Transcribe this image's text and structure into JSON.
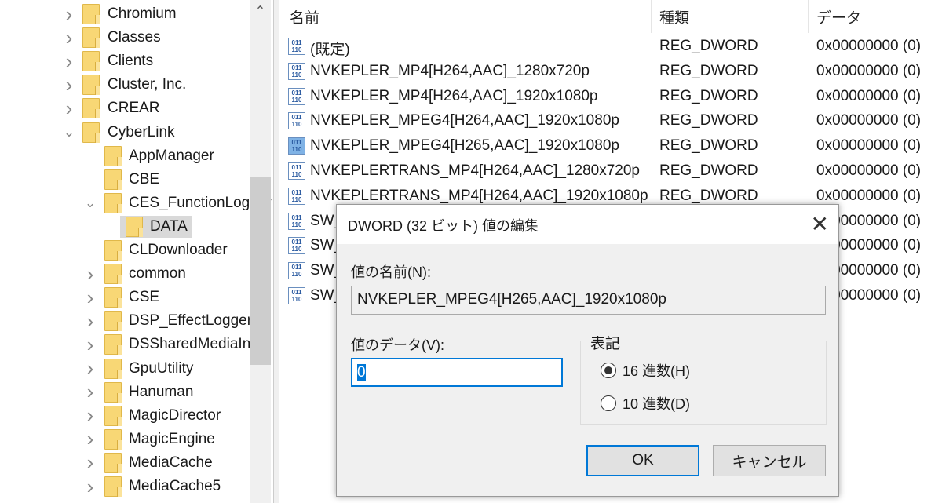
{
  "tree": {
    "items": [
      {
        "label": "Chromium",
        "level": 1,
        "state": "collapsed"
      },
      {
        "label": "Classes",
        "level": 1,
        "state": "collapsed"
      },
      {
        "label": "Clients",
        "level": 1,
        "state": "collapsed"
      },
      {
        "label": "Cluster, Inc.",
        "level": 1,
        "state": "collapsed"
      },
      {
        "label": "CREAR",
        "level": 1,
        "state": "collapsed"
      },
      {
        "label": "CyberLink",
        "level": 1,
        "state": "expanded"
      },
      {
        "label": "AppManager",
        "level": 2,
        "state": "leaf"
      },
      {
        "label": "CBE",
        "level": 2,
        "state": "leaf"
      },
      {
        "label": "CES_FunctionLogger",
        "level": 2,
        "state": "expanded"
      },
      {
        "label": "DATA",
        "level": 3,
        "state": "leaf",
        "selected": true
      },
      {
        "label": "CLDownloader",
        "level": 2,
        "state": "leaf"
      },
      {
        "label": "common",
        "level": 2,
        "state": "collapsed"
      },
      {
        "label": "CSE",
        "level": 2,
        "state": "collapsed"
      },
      {
        "label": "DSP_EffectLogger",
        "level": 2,
        "state": "collapsed"
      },
      {
        "label": "DSSharedMediaInfo",
        "level": 2,
        "state": "collapsed"
      },
      {
        "label": "GpuUtility",
        "level": 2,
        "state": "collapsed"
      },
      {
        "label": "Hanuman",
        "level": 2,
        "state": "collapsed"
      },
      {
        "label": "MagicDirector",
        "level": 2,
        "state": "collapsed"
      },
      {
        "label": "MagicEngine",
        "level": 2,
        "state": "collapsed"
      },
      {
        "label": "MediaCache",
        "level": 2,
        "state": "collapsed"
      },
      {
        "label": "MediaCache5",
        "level": 2,
        "state": "collapsed"
      }
    ]
  },
  "list": {
    "columns": {
      "name": "名前",
      "type": "種類",
      "data": "データ"
    },
    "rows": [
      {
        "name": "(既定)",
        "type": "REG_DWORD",
        "data": "0x00000000 (0)"
      },
      {
        "name": "NVKEPLER_MP4[H264,AAC]_1280x720p",
        "type": "REG_DWORD",
        "data": "0x00000000 (0)"
      },
      {
        "name": "NVKEPLER_MP4[H264,AAC]_1920x1080p",
        "type": "REG_DWORD",
        "data": "0x00000000 (0)"
      },
      {
        "name": "NVKEPLER_MPEG4[H264,AAC]_1920x1080p",
        "type": "REG_DWORD",
        "data": "0x00000000 (0)"
      },
      {
        "name": "NVKEPLER_MPEG4[H265,AAC]_1920x1080p",
        "type": "REG_DWORD",
        "data": "0x00000000 (0)",
        "selected": true
      },
      {
        "name": "NVKEPLERTRANS_MP4[H264,AAC]_1280x720p",
        "type": "REG_DWORD",
        "data": "0x00000000 (0)"
      },
      {
        "name": "NVKEPLERTRANS_MP4[H264,AAC]_1920x1080p",
        "type": "REG_DWORD",
        "data": "0x00000000 (0)"
      },
      {
        "name": "SW_",
        "type": "",
        "data": "0x00000000 (0)"
      },
      {
        "name": "SW_",
        "type": "",
        "data": "0x00000000 (0)"
      },
      {
        "name": "SW_",
        "type": "",
        "data": "0x00000000 (0)"
      },
      {
        "name": "SW_",
        "type": "",
        "data": "0x00000000 (0)"
      }
    ]
  },
  "dialog": {
    "title": "DWORD (32 ビット) 値の編集",
    "name_label": "値の名前(N):",
    "name_value": "NVKEPLER_MPEG4[H265,AAC]_1920x1080p",
    "data_label": "値のデータ(V):",
    "data_value": "0",
    "base_label": "表記",
    "hex_label": "16 進数(H)",
    "dec_label": "10 進数(D)",
    "selected_base": "hex",
    "ok_label": "OK",
    "cancel_label": "キャンセル",
    "close_icon": "close-icon"
  },
  "colors": {
    "accent": "#0078d7",
    "folder": "#f8d775"
  }
}
